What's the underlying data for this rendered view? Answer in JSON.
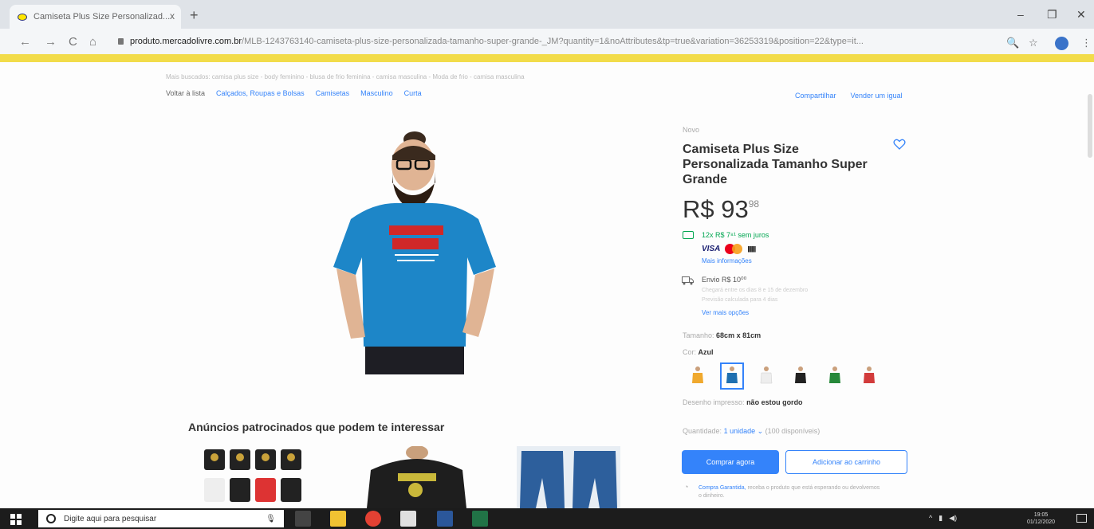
{
  "browser": {
    "tab_title": "Camiseta Plus Size Personalizad...",
    "tab_close": "x",
    "new_tab": "+",
    "window_min": "–",
    "window_max": "❐",
    "window_close": "✕",
    "back": "←",
    "forward": "→",
    "reload": "C",
    "home": "⌂",
    "url_host": "produto.mercadolivre.com.br",
    "url_path": "/MLB-1243763140-camiseta-plus-size-personalizada-tamanho-super-grande-_JM?quantity=1&noAttributes&tp=true&variation=36253319&position=22&type=it...",
    "zoom_icon": "🔍",
    "star_icon": "☆",
    "menu_icon": "⋮"
  },
  "breadcrumb": {
    "history": "Mais buscados: camisa plus size - body feminino - blusa de frio feminina - camisa masculina - Moda de frio - camisa masculina",
    "back_label": "Voltar à lista",
    "items": [
      "Calçados, Roupas e Bolsas",
      "Camisetas",
      "Masculino",
      "Curta"
    ],
    "share": "Compartilhar",
    "sell": "Vender um igual"
  },
  "product": {
    "condition": "Novo",
    "title": "Camiseta Plus Size Personalizada Tamanho Super Grande",
    "price_int": "R$ 93",
    "price_cents": "98",
    "installments": "12x R$ 7⁸¹ sem juros",
    "card_visa": "VISA",
    "card_boleto": "||||||||",
    "more_info": "Mais informações",
    "shipping": "Envio R$ 10⁰⁰",
    "shipping_sub1": "Chegará entre os dias 8 e 15 de dezembro",
    "shipping_sub2": "Previsão calculada para 4 dias",
    "shipping_more": "Ver mais opções",
    "size_label": "Tamanho:",
    "size_value": "68cm x 81cm",
    "color_label": "Cor:",
    "color_value": "Azul",
    "swatch_colors": [
      "#f0a92e",
      "#1f6fb0",
      "#f3f3f3",
      "#222222",
      "#27893a",
      "#d23b3b"
    ],
    "drawing_label": "Desenho impresso:",
    "drawing_value": "não estou gordo",
    "qty_label": "Quantidade:",
    "qty_value": "1 unidade ⌄",
    "qty_available": "(100 disponíveis)",
    "buy_now": "Comprar agora",
    "add_cart": "Adicionar ao carrinho",
    "guarantee_link": "Compra Garantida,",
    "guarantee_text": "receba o produto que está esperando ou devolvemos o dinheiro."
  },
  "ads": {
    "title": "Anúncios patrocinados que podem te interessar"
  },
  "taskbar": {
    "search_placeholder": "Digite aqui para pesquisar",
    "time": "19:05",
    "date": "01/12/2020",
    "app_colors": [
      "#f1c232",
      "#e34133",
      "#e0e0e0",
      "#2b579a",
      "#217346"
    ]
  },
  "colors": {
    "accent": "#3483fa",
    "brand_yellow": "#f2dc4a",
    "green": "#00a650"
  }
}
